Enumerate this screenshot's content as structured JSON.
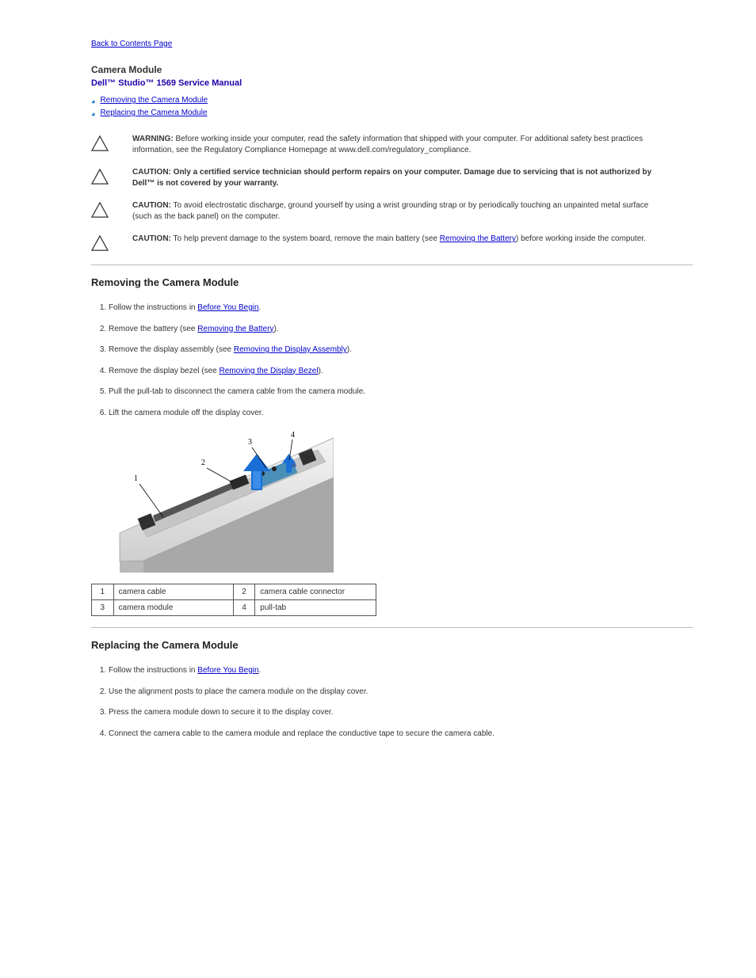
{
  "back_link": "Back to Contents Page",
  "page_heading": "Camera Module",
  "manual_title": "Dell™ Studio™ 1569 Service Manual",
  "toc": [
    "Removing the Camera Module",
    "Replacing the Camera Module"
  ],
  "warning": {
    "lead": "WARNING:",
    "body": "Before working inside your computer, read the safety information that shipped with your computer. For additional safety best practices information, see the Regulatory Compliance Homepage at www.dell.com/regulatory_compliance."
  },
  "cautions": [
    {
      "lead": "CAUTION:",
      "body_before": "",
      "body_bold": "Only a certified service technician should perform repairs on your computer. Damage due to servicing that is not authorized by Dell™ is not covered by your warranty.",
      "body_after": ""
    },
    {
      "lead": "CAUTION:",
      "body": "To avoid electrostatic discharge, ground yourself by using a wrist grounding strap or by periodically touching an unpainted metal surface (such as the back panel) on the computer."
    },
    {
      "lead": "CAUTION:",
      "body_before": "To help prevent damage to the system board, remove the main battery (see ",
      "link": "Removing the Battery",
      "body_after": ") before working inside the computer."
    }
  ],
  "section_remove": {
    "heading": "Removing the Camera Module",
    "steps": [
      {
        "before": "Follow the instructions in ",
        "link": "Before You Begin",
        "after": "."
      },
      {
        "before": "Remove the battery (see ",
        "link": "Removing the Battery",
        "after": ")."
      },
      {
        "before": "Remove the display assembly (see ",
        "link": "Removing the Display Assembly",
        "after": ")."
      },
      {
        "before": "Remove the display bezel (see ",
        "link": "Removing the Display Bezel",
        "after": ")."
      },
      {
        "before": "Pull the pull-tab to disconnect the camera cable from the camera module.",
        "link": "",
        "after": ""
      },
      {
        "before": "Lift the camera module off the display cover.",
        "link": "",
        "after": ""
      }
    ]
  },
  "parts_table": {
    "rows": [
      {
        "n1": "1",
        "l1": "camera cable",
        "n2": "2",
        "l2": "camera cable connector"
      },
      {
        "n1": "3",
        "l1": "camera module",
        "n2": "4",
        "l2": "pull-tab"
      }
    ]
  },
  "section_replace": {
    "heading": "Replacing the Camera Module",
    "steps": [
      {
        "before": "Follow the instructions in ",
        "link": "Before You Begin",
        "after": "."
      },
      {
        "before": "Use the alignment posts to place the camera module on the display cover.",
        "link": "",
        "after": ""
      },
      {
        "before": "Press the camera module down to secure it to the display cover.",
        "link": "",
        "after": ""
      },
      {
        "before": "Connect the camera cable to the camera module and replace the conductive tape to secure the camera cable.",
        "link": "",
        "after": ""
      }
    ]
  }
}
